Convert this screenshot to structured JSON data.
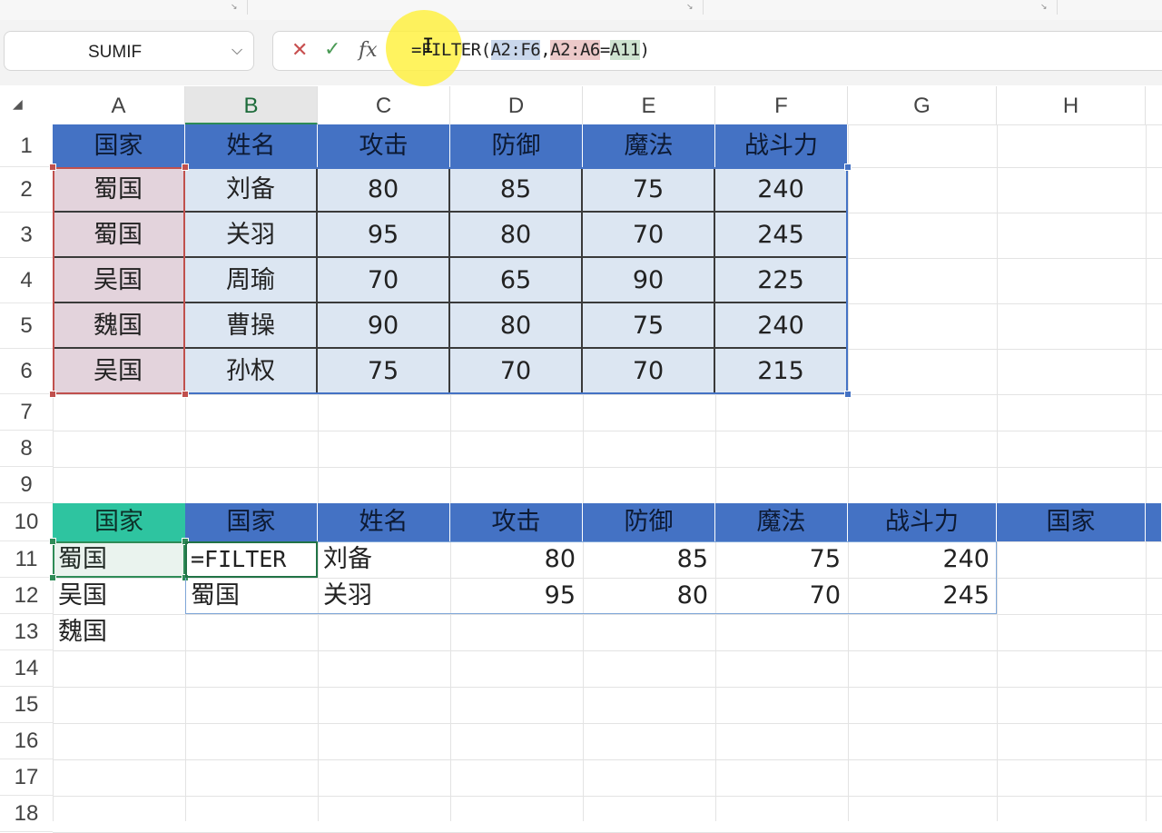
{
  "name_box": {
    "value": "SUMIF"
  },
  "formula_bar": {
    "segments": [
      {
        "text": "=FILTER(",
        "hl": ""
      },
      {
        "text": "A2:F6",
        "hl": "blue"
      },
      {
        "text": ",",
        "hl": ""
      },
      {
        "text": "A2:A6",
        "hl": "red"
      },
      {
        "text": "=",
        "hl": ""
      },
      {
        "text": "A11",
        "hl": "green"
      },
      {
        "text": ")",
        "hl": ""
      }
    ]
  },
  "columns": [
    "A",
    "B",
    "C",
    "D",
    "E",
    "F",
    "G",
    "H"
  ],
  "active_column": "B",
  "rows": [
    "1",
    "2",
    "3",
    "4",
    "5",
    "6",
    "7",
    "8",
    "9",
    "10",
    "11",
    "12",
    "13",
    "14",
    "15",
    "16",
    "17",
    "18"
  ],
  "source_table": {
    "headers": [
      "国家",
      "姓名",
      "攻击",
      "防御",
      "魔法",
      "战斗力"
    ],
    "rows": [
      [
        "蜀国",
        "刘备",
        "80",
        "85",
        "75",
        "240"
      ],
      [
        "蜀国",
        "关羽",
        "95",
        "80",
        "70",
        "245"
      ],
      [
        "吴国",
        "周瑜",
        "70",
        "65",
        "90",
        "225"
      ],
      [
        "魏国",
        "曹操",
        "90",
        "80",
        "75",
        "240"
      ],
      [
        "吴国",
        "孙权",
        "75",
        "70",
        "70",
        "215"
      ]
    ]
  },
  "criteria": {
    "header": "国家",
    "values": [
      "蜀国",
      "吴国",
      "魏国"
    ]
  },
  "result_table": {
    "headers": [
      "国家",
      "姓名",
      "攻击",
      "防御",
      "魔法",
      "战斗力",
      "国家"
    ],
    "edit_text": "=FILTER",
    "rows": [
      [
        "",
        "刘备",
        "80",
        "85",
        "75",
        "240"
      ],
      [
        "蜀国",
        "关羽",
        "95",
        "80",
        "70",
        "245"
      ]
    ]
  },
  "colors": {
    "header_fill": "#4472c4",
    "criteria_header_fill": "#2ec4a0",
    "table_fill": "#dce6f2",
    "range_blue": "#4472c4",
    "range_red": "#c0504d",
    "range_green": "#2e8b57",
    "cursor_halo": "#fff03c"
  }
}
